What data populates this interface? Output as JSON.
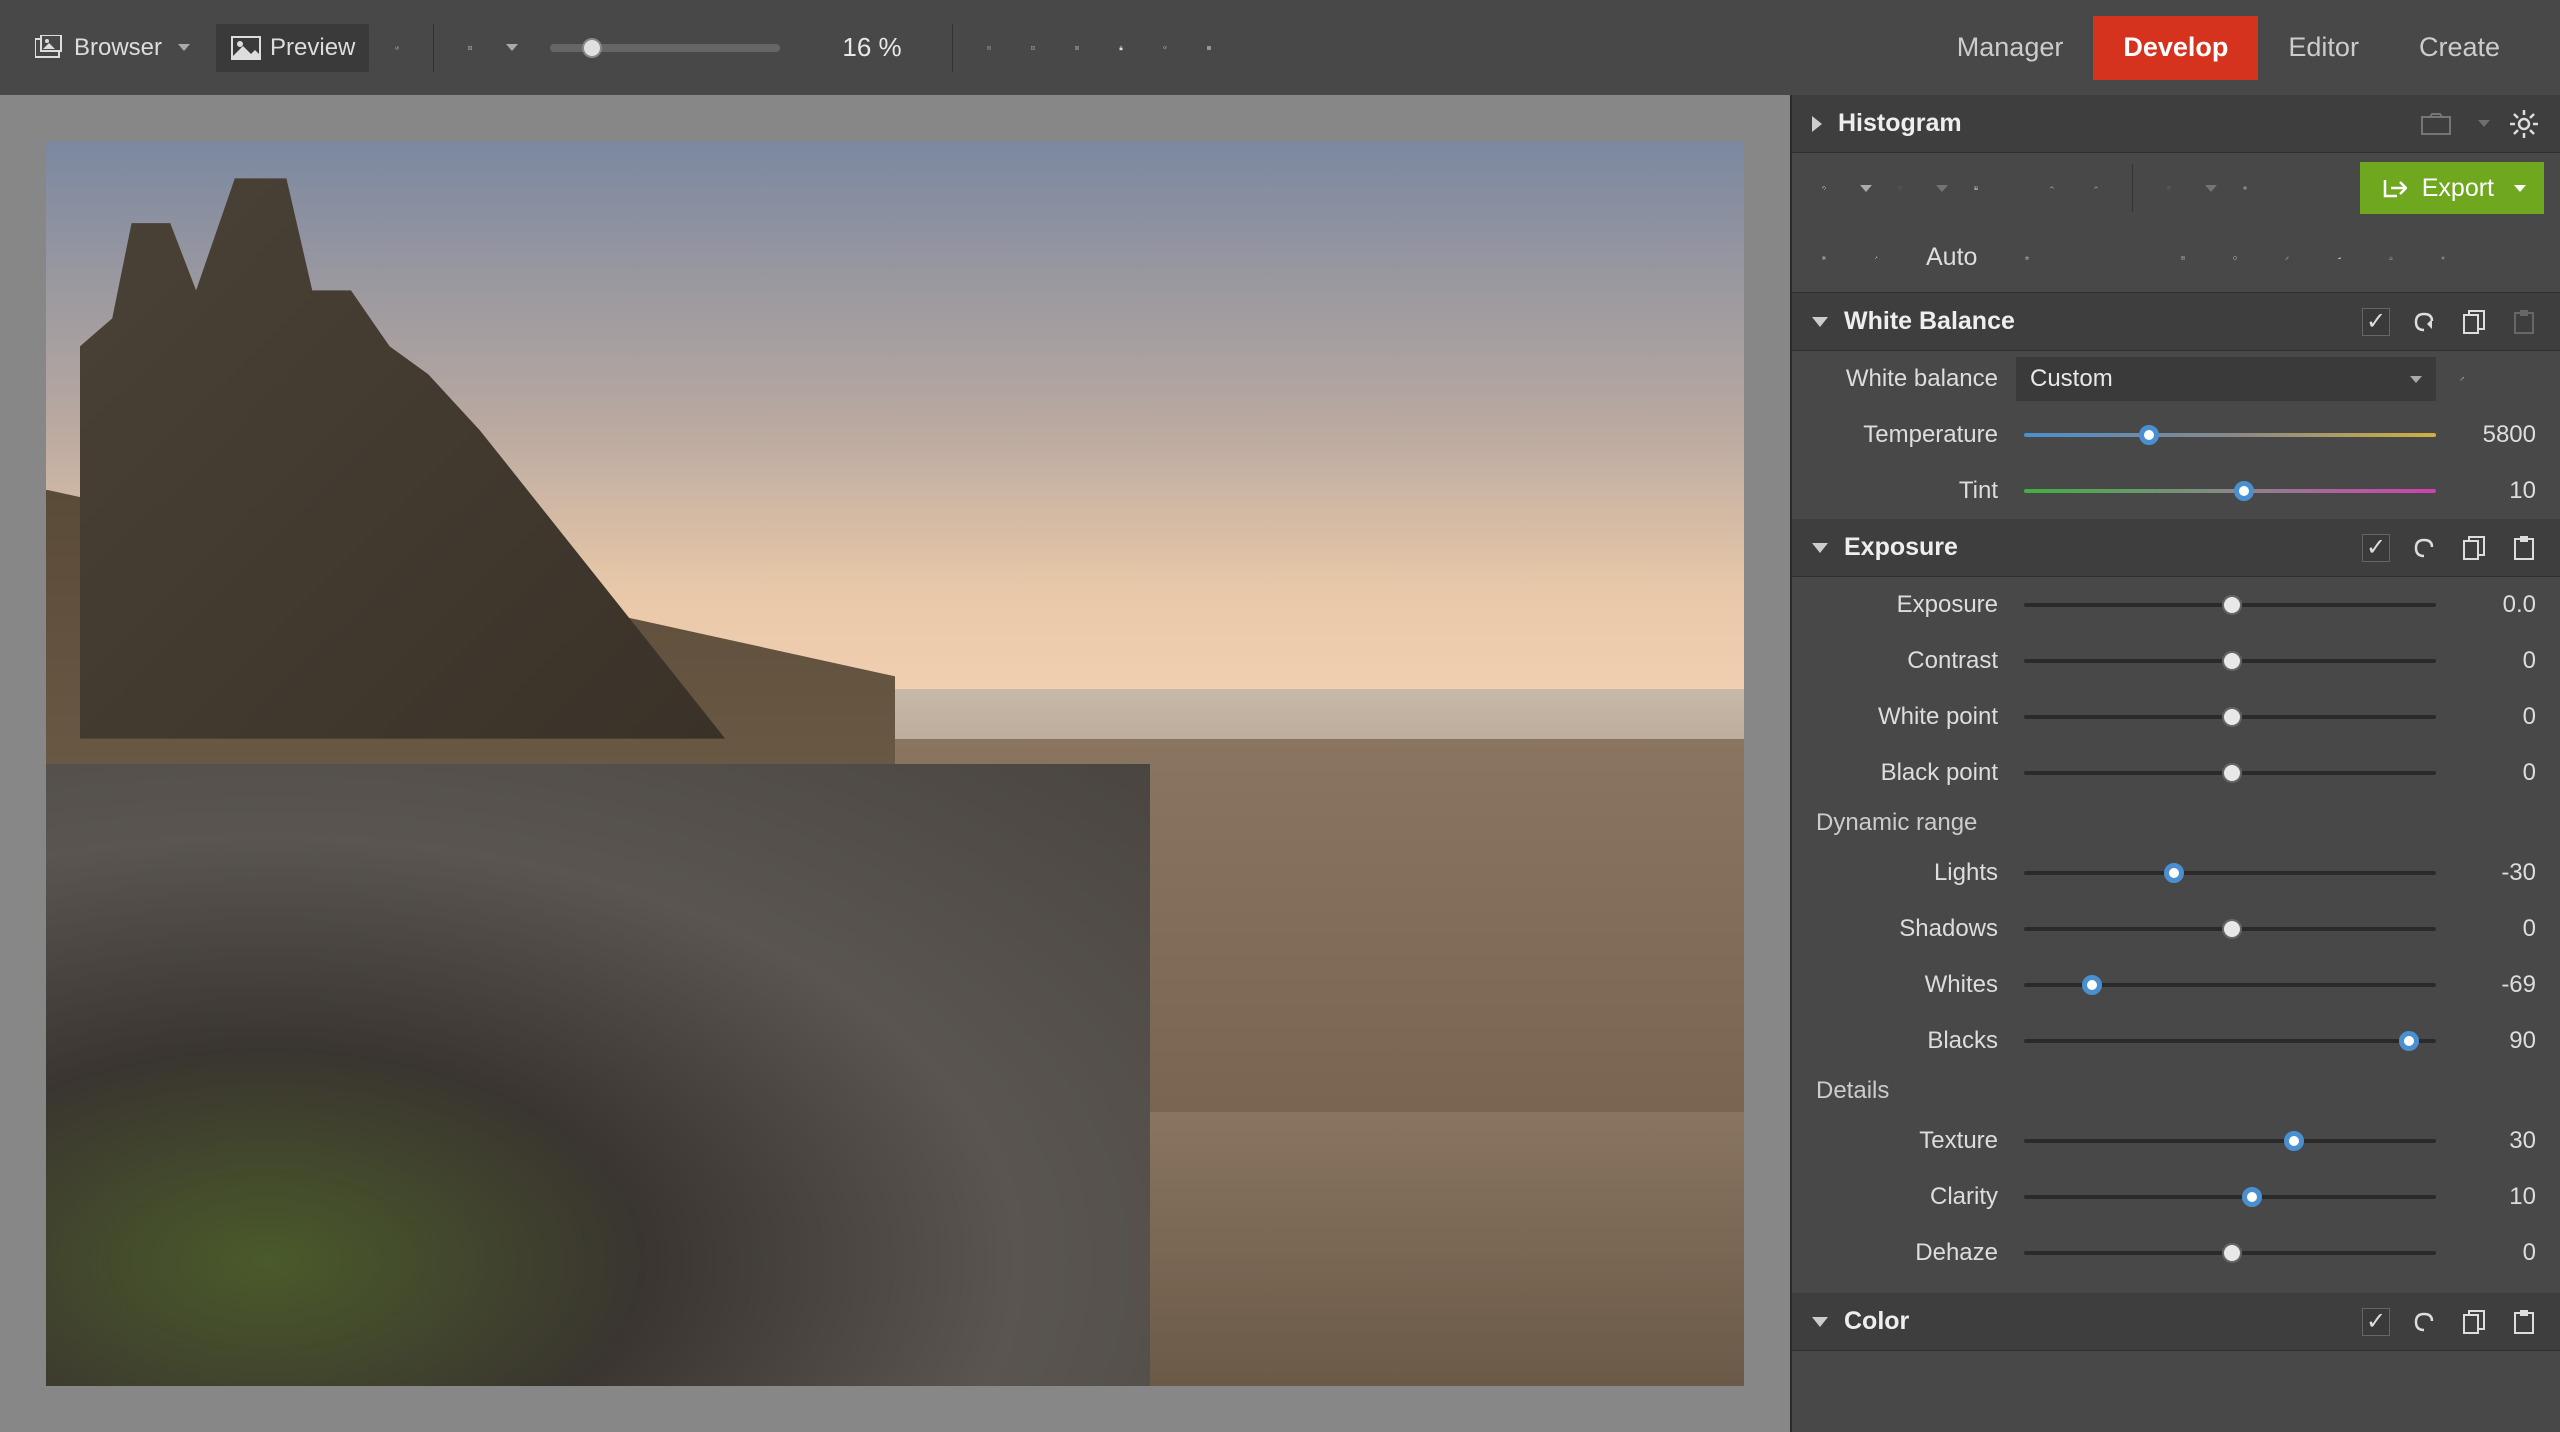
{
  "toolbar": {
    "browser": "Browser",
    "preview": "Preview",
    "zoom": "16 %"
  },
  "tabs": {
    "manager": "Manager",
    "develop": "Develop",
    "editor": "Editor",
    "create": "Create"
  },
  "panel": {
    "histogram": "Histogram",
    "export": "Export",
    "auto": "Auto",
    "white_balance": {
      "title": "White Balance",
      "wb_label": "White balance",
      "wb_value": "Custom",
      "temperature_label": "Temperature",
      "temperature_value": "5800",
      "tint_label": "Tint",
      "tint_value": "10"
    },
    "exposure": {
      "title": "Exposure",
      "exposure_label": "Exposure",
      "exposure_value": "0.0",
      "contrast_label": "Contrast",
      "contrast_value": "0",
      "white_point_label": "White point",
      "white_point_value": "0",
      "black_point_label": "Black point",
      "black_point_value": "0",
      "dynamic_range": "Dynamic range",
      "lights_label": "Lights",
      "lights_value": "-30",
      "shadows_label": "Shadows",
      "shadows_value": "0",
      "whites_label": "Whites",
      "whites_value": "-69",
      "blacks_label": "Blacks",
      "blacks_value": "90",
      "details": "Details",
      "texture_label": "Texture",
      "texture_value": "30",
      "clarity_label": "Clarity",
      "clarity_value": "10",
      "dehaze_label": "Dehaze",
      "dehaze_value": "0"
    },
    "color": {
      "title": "Color"
    }
  }
}
